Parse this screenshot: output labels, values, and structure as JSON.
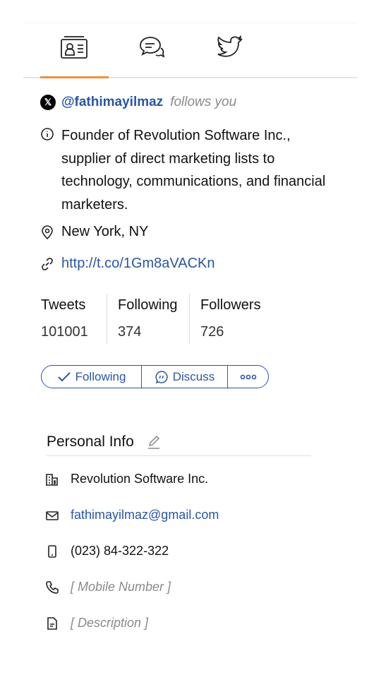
{
  "tabs": [
    {
      "icon": "contact-card-icon",
      "active": true
    },
    {
      "icon": "chat-bubbles-icon"
    },
    {
      "icon": "twitter-bird-icon"
    }
  ],
  "accent": "#f0913b",
  "profile": {
    "handle": "@fathimayilmaz",
    "follows_you": "follows you",
    "bio_lines": [
      "Founder of Revolution Software Inc.,",
      "supplier of direct marketing lists to",
      "technology, communications, and financial",
      "marketers."
    ],
    "location": "New York, NY",
    "link": "http://t.co/1Gm8aVACKn",
    "stats": [
      {
        "label": "Tweets",
        "value": "101001"
      },
      {
        "label": "Following",
        "value": "374"
      },
      {
        "label": "Followers",
        "value": "726"
      }
    ]
  },
  "actions": {
    "following": "Following",
    "discuss": "Discuss",
    "more": "more-icon"
  },
  "personal_info": {
    "title": "Personal Info",
    "company": "Revolution Software Inc.",
    "email": "fathimayilmaz@gmail.com",
    "phone": "(023) 84-322-322",
    "mobile_placeholder": "[ Mobile Number ]",
    "description_placeholder": "[ Description ]"
  }
}
